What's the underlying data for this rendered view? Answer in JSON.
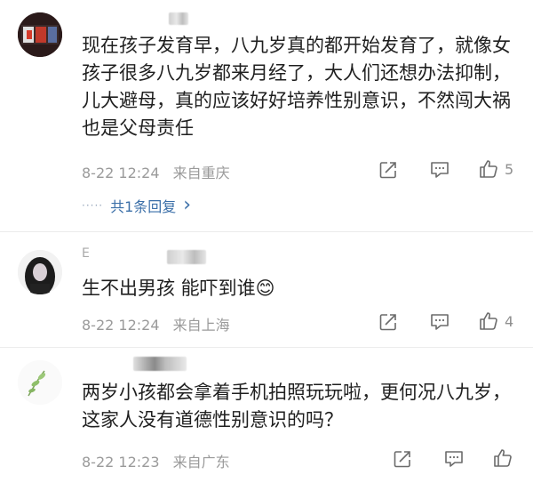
{
  "comments": [
    {
      "username": "",
      "content": "现在孩子发育早，八九岁真的都开始发育了，就像女孩子很多八九岁都来月经了，大人们还想办法抑制，儿大避母，真的应该好好培养性别意识，不然闯大祸也是父母责任",
      "time": "8-22 12:24",
      "location": "来自重庆",
      "likes": "5",
      "replies_label": "共1条回复",
      "replies_chevron": "›"
    },
    {
      "username": "E",
      "content": "生不出男孩 能吓到谁😊",
      "time": "8-22 12:24",
      "location": "来自上海",
      "likes": "4"
    },
    {
      "username": "",
      "content": "两岁小孩都会拿着手机拍照玩玩啦，更何况八九岁，这家人没有道德性别意识的吗？",
      "time": "8-22 12:23",
      "location": "来自广东",
      "likes": ""
    }
  ],
  "colors": {
    "reply_link": "#3b6fa8",
    "meta_text": "#9a9a9a",
    "icon_stroke": "#6b6b6b"
  },
  "icons": [
    "share-icon",
    "comment-icon",
    "like-icon",
    "chevron-right-icon"
  ]
}
